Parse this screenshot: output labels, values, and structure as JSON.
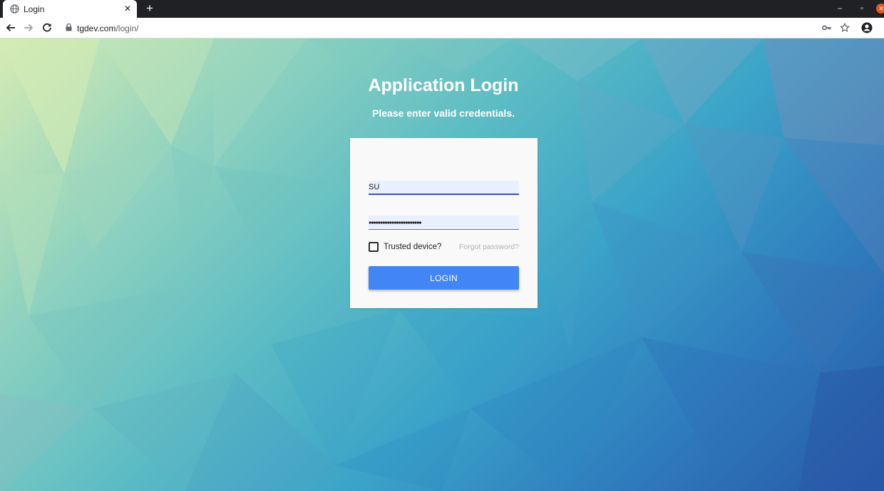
{
  "browser": {
    "tab": {
      "title": "Login",
      "favicon": "globe-icon",
      "close_icon": "close-icon"
    },
    "new_tab_icon": "plus-icon",
    "window_controls": {
      "minimize": "–",
      "maximize": "▫",
      "close": "✕"
    },
    "address": {
      "host": "tgdev.com",
      "path": "/login/",
      "lock_icon": "lock-icon"
    },
    "toolbar_icons": [
      "back-icon",
      "forward-icon",
      "reload-icon",
      "key-icon",
      "star-icon",
      "account-icon"
    ]
  },
  "page": {
    "heading": "Application Login",
    "subheading": "Please enter valid credentials."
  },
  "login_form": {
    "username_value": "SU",
    "password_value": "•••••••••••••••••••••••",
    "trusted_device_label": "Trusted device?",
    "trusted_device_checked": false,
    "forgot_password_label": "Forgot password?",
    "login_button_label": "LOGIN"
  },
  "colors": {
    "button_blue": "#4285f4",
    "field_background": "#e8f0fe",
    "field_underline_active": "#3f51b5"
  }
}
